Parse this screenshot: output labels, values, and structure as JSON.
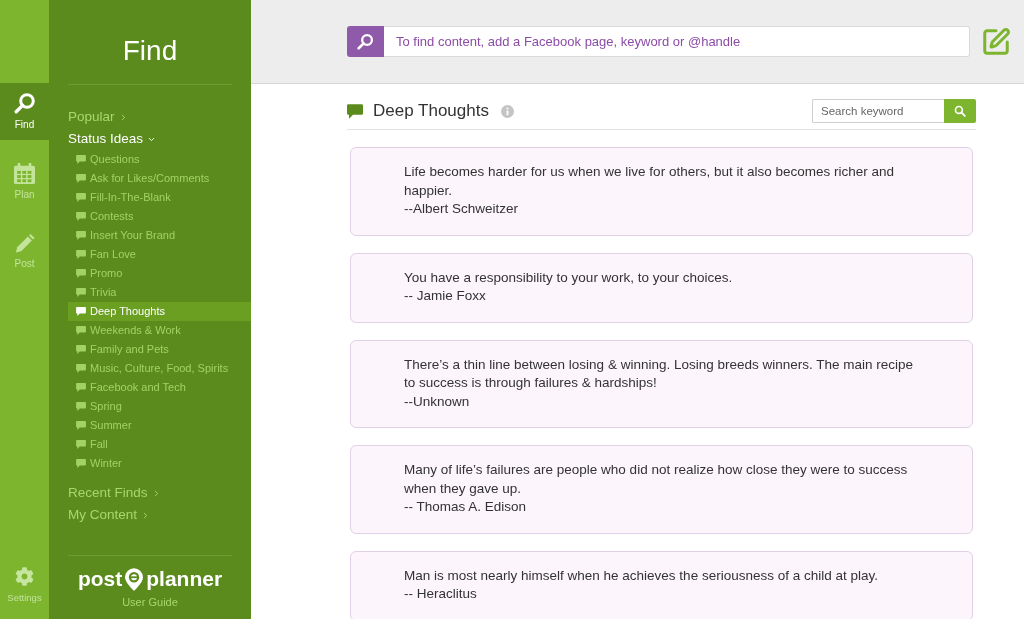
{
  "rail": {
    "items": [
      {
        "label": "Find",
        "selected": true
      },
      {
        "label": "Plan",
        "selected": false
      },
      {
        "label": "Post",
        "selected": false
      }
    ],
    "settings": {
      "label": "Settings"
    }
  },
  "sidebar": {
    "title": "Find",
    "sections": [
      {
        "label": "Popular",
        "expanded": false
      },
      {
        "label": "Status Ideas",
        "expanded": true,
        "children": [
          {
            "label": "Questions",
            "selected": false
          },
          {
            "label": "Ask for Likes/Comments",
            "selected": false
          },
          {
            "label": "Fill-In-The-Blank",
            "selected": false
          },
          {
            "label": "Contests",
            "selected": false
          },
          {
            "label": "Insert Your Brand",
            "selected": false
          },
          {
            "label": "Fan Love",
            "selected": false
          },
          {
            "label": "Promo",
            "selected": false
          },
          {
            "label": "Trivia",
            "selected": false
          },
          {
            "label": "Deep Thoughts",
            "selected": true
          },
          {
            "label": "Weekends & Work",
            "selected": false
          },
          {
            "label": "Family and Pets",
            "selected": false
          },
          {
            "label": "Music, Culture, Food, Spirits",
            "selected": false
          },
          {
            "label": "Facebook and Tech",
            "selected": false
          },
          {
            "label": "Spring",
            "selected": false
          },
          {
            "label": "Summer",
            "selected": false
          },
          {
            "label": "Fall",
            "selected": false
          },
          {
            "label": "Winter",
            "selected": false
          }
        ]
      },
      {
        "label": "Recent Finds",
        "expanded": false
      },
      {
        "label": "My Content",
        "expanded": false
      }
    ],
    "logo": {
      "left": "post",
      "right": "planner"
    },
    "user_guide": "User Guide"
  },
  "top_bar": {
    "search": {
      "placeholder": "To find content, add a Facebook page, keyword or @handle"
    }
  },
  "content": {
    "title": "Deep Thoughts",
    "search": {
      "placeholder": "Search keyword"
    },
    "cards": [
      {
        "quote": "Life becomes harder for us when we live for others, but it also becomes richer and happier.",
        "author": "--Albert Schweitzer"
      },
      {
        "quote": "You have a responsibility to your work, to your choices.",
        "author": "-- Jamie Foxx"
      },
      {
        "quote": "There’s a thin line between losing & winning. Losing breeds winners. The main recipe to success is through failures & hardships!",
        "author": "--Unknown"
      },
      {
        "quote": "Many of life’s failures are people who did not realize how close they were to success when they gave up.",
        "author": "-- Thomas A. Edison"
      },
      {
        "quote": "Man is most nearly himself when he achieves the seriousness of a child at play.",
        "author": "-- Heraclitus"
      }
    ]
  }
}
